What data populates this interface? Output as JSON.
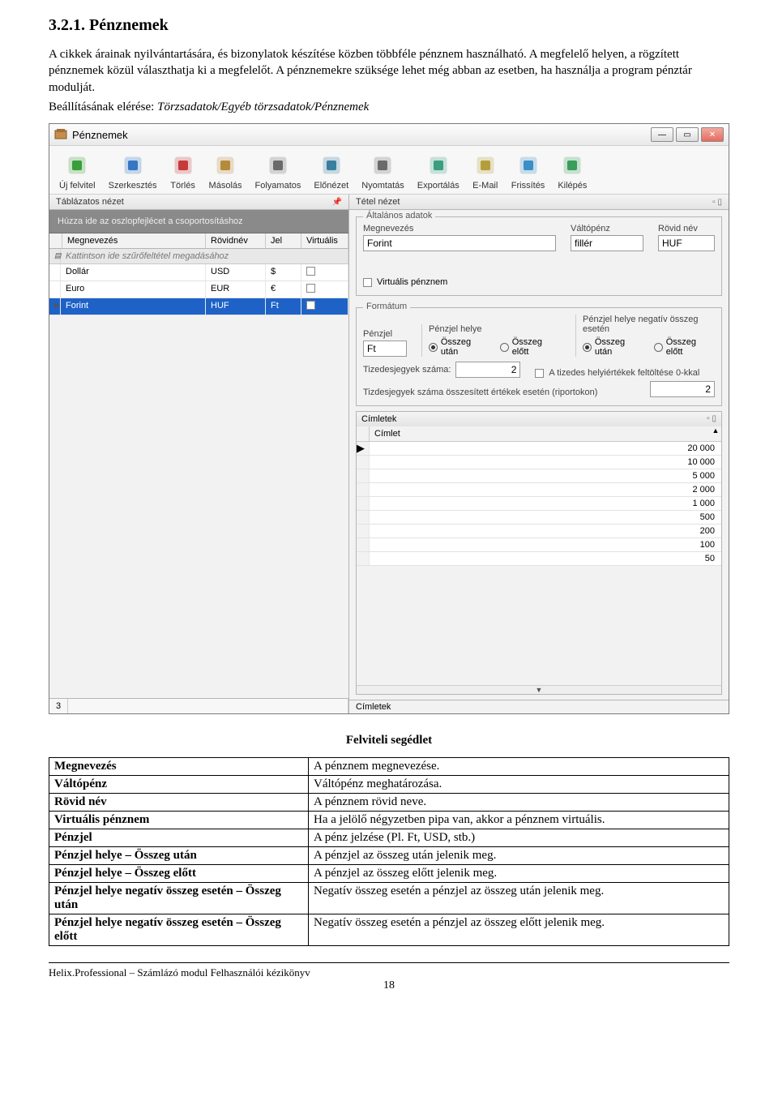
{
  "doc": {
    "heading": "3.2.1. Pénznemek",
    "p1": "A cikkek árainak nyilvántartására, és bizonylatok készítése közben többféle pénznem használható. A megfelelő helyen, a rögzített pénznemek közül választhatja ki a megfelelőt. A pénznemekre szüksége lehet még abban az esetben, ha használja a program pénztár modulját.",
    "p2_prefix": "Beállításának elérése: ",
    "p2_path": "Törzsadatok/Egyéb törzsadatok/Pénznemek"
  },
  "window": {
    "title": "Pénznemek"
  },
  "toolbar": [
    {
      "icon": "#3a9e3a",
      "label": "Új felvitel",
      "name": "new-button"
    },
    {
      "icon": "#3576c4",
      "label": "Szerkesztés",
      "name": "edit-button"
    },
    {
      "icon": "#c63a3a",
      "label": "Törlés",
      "name": "delete-button"
    },
    {
      "icon": "#b58b3a",
      "label": "Másolás",
      "name": "copy-button"
    },
    {
      "icon": "#6a6a6a",
      "label": "Folyamatos",
      "name": "continuous-button"
    },
    {
      "icon": "#3a7fa0",
      "label": "Előnézet",
      "name": "preview-button"
    },
    {
      "icon": "#6a6a6a",
      "label": "Nyomtatás",
      "name": "print-button"
    },
    {
      "icon": "#3a9e7f",
      "label": "Exportálás",
      "name": "export-button"
    },
    {
      "icon": "#b59e3a",
      "label": "E-Mail",
      "name": "email-button"
    },
    {
      "icon": "#3a8fc6",
      "label": "Frissítés",
      "name": "refresh-button"
    },
    {
      "icon": "#3a9e5a",
      "label": "Kilépés",
      "name": "exit-button"
    }
  ],
  "left_panel": {
    "title": "Táblázatos nézet",
    "group_hint": "Húzza ide az oszlopfejlécet a csoportosításhoz",
    "columns": [
      "Megnevezés",
      "Rövidnév",
      "Jel",
      "Virtuális"
    ],
    "filter_hint": "Kattintson ide szűrőfeltétel megadásához",
    "rows": [
      {
        "name": "Dollár",
        "short": "USD",
        "sign": "$",
        "virtual": false,
        "selected": false
      },
      {
        "name": "Euro",
        "short": "EUR",
        "sign": "€",
        "virtual": false,
        "selected": false
      },
      {
        "name": "Forint",
        "short": "HUF",
        "sign": "Ft",
        "virtual": false,
        "selected": true
      }
    ],
    "status_count": "3"
  },
  "right_panel": {
    "title": "Tétel nézet",
    "general": {
      "legend": "Általános adatok",
      "name_label": "Megnevezés",
      "name_value": "Forint",
      "change_label": "Váltópénz",
      "change_value": "fillér",
      "short_label": "Rövid név",
      "short_value": "HUF",
      "virtual_label": "Virtuális pénznem",
      "virtual_checked": false
    },
    "format": {
      "legend": "Formátum",
      "sign_label": "Pénzjel",
      "sign_value": "Ft",
      "place_label": "Pénzjel helye",
      "after_label": "Összeg után",
      "before_label": "Összeg előtt",
      "neg_label": "Pénzjel helye negatív összeg esetén",
      "decimals_label": "Tizedesjegyek száma:",
      "decimals_value": "2",
      "zerofill_label": "A tizedes helyiértékek feltöltése 0-kkal",
      "report_label": "Tizdesjegyek száma összesített értékek esetén (riportokon)",
      "report_value": "2"
    },
    "cim": {
      "title": "Címletek",
      "col": "Címlet",
      "rows": [
        "20 000",
        "10 000",
        "5 000",
        "2 000",
        "1 000",
        "500",
        "200",
        "100",
        "50"
      ],
      "tab": "Címletek"
    }
  },
  "seg": {
    "title": "Felviteli segédlet",
    "rows": [
      [
        "Megnevezés",
        "A pénznem megnevezése."
      ],
      [
        "Váltópénz",
        "Váltópénz meghatározása."
      ],
      [
        "Rövid név",
        "A pénznem rövid neve."
      ],
      [
        "Virtuális pénznem",
        "Ha a jelölő négyzetben pipa van, akkor a pénznem virtuális."
      ],
      [
        "Pénzjel",
        "A pénz jelzése (Pl. Ft, USD, stb.)"
      ],
      [
        "Pénzjel helye – Összeg után",
        "A pénzjel az összeg után jelenik meg."
      ],
      [
        "Pénzjel helye – Összeg előtt",
        "A pénzjel az összeg előtt jelenik meg."
      ],
      [
        "Pénzjel helye negatív összeg esetén – Összeg után",
        "Negatív összeg esetén a pénzjel az összeg után jelenik meg."
      ],
      [
        "Pénzjel helye negatív összeg esetén – Összeg előtt",
        "Negatív összeg esetén a pénzjel az összeg előtt jelenik meg."
      ]
    ]
  },
  "footer": {
    "text": "Helix.Professional – Számlázó modul Felhasználói kézikönyv",
    "page": "18"
  }
}
